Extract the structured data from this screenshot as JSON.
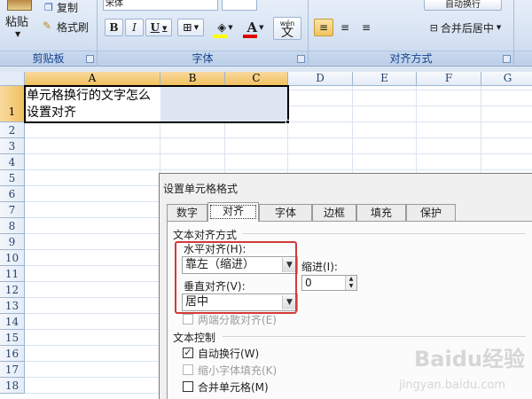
{
  "ribbon": {
    "clipboard": {
      "paste": "粘贴",
      "copy": "复制",
      "format_painter": "格式刷",
      "label": "剪贴板"
    },
    "font": {
      "font_name": "宋体",
      "bold": "B",
      "italic": "I",
      "underline": "U",
      "wen": "wén",
      "label": "字体",
      "fill_color": "#ffff00",
      "font_color": "#e00000"
    },
    "alignment": {
      "wrap_text": "自动换行",
      "merge_center": "合并后居中",
      "label": "对齐方式"
    }
  },
  "sheet": {
    "columns": [
      "A",
      "B",
      "C",
      "D",
      "E",
      "F",
      "G"
    ],
    "rows": [
      "1",
      "2",
      "3",
      "4",
      "5",
      "6",
      "7",
      "8",
      "9",
      "10",
      "11",
      "12",
      "13",
      "14",
      "15",
      "16",
      "17",
      "18"
    ],
    "a1_value": "单元格换行的文字怎么设置对齐"
  },
  "dialog": {
    "title": "设置单元格格式",
    "tabs": [
      "数字",
      "对齐",
      "字体",
      "边框",
      "填充",
      "保护"
    ],
    "active_tab": "对齐",
    "text_align_section": "文本对齐方式",
    "horizontal_label": "水平对齐(H):",
    "horizontal_value": "靠左（缩进）",
    "indent_label": "缩进(I):",
    "indent_value": "0",
    "vertical_label": "垂直对齐(V):",
    "vertical_value": "居中",
    "distributed_label": "两端分散对齐(E)",
    "text_control_section": "文本控制",
    "wrap_label": "自动换行(W)",
    "wrap_checked": true,
    "shrink_label": "缩小字体填充(K)",
    "merge_label": "合并单元格(M)"
  },
  "watermark": {
    "brand": "Baidu经验",
    "sub": "jingyan.baidu.com"
  }
}
